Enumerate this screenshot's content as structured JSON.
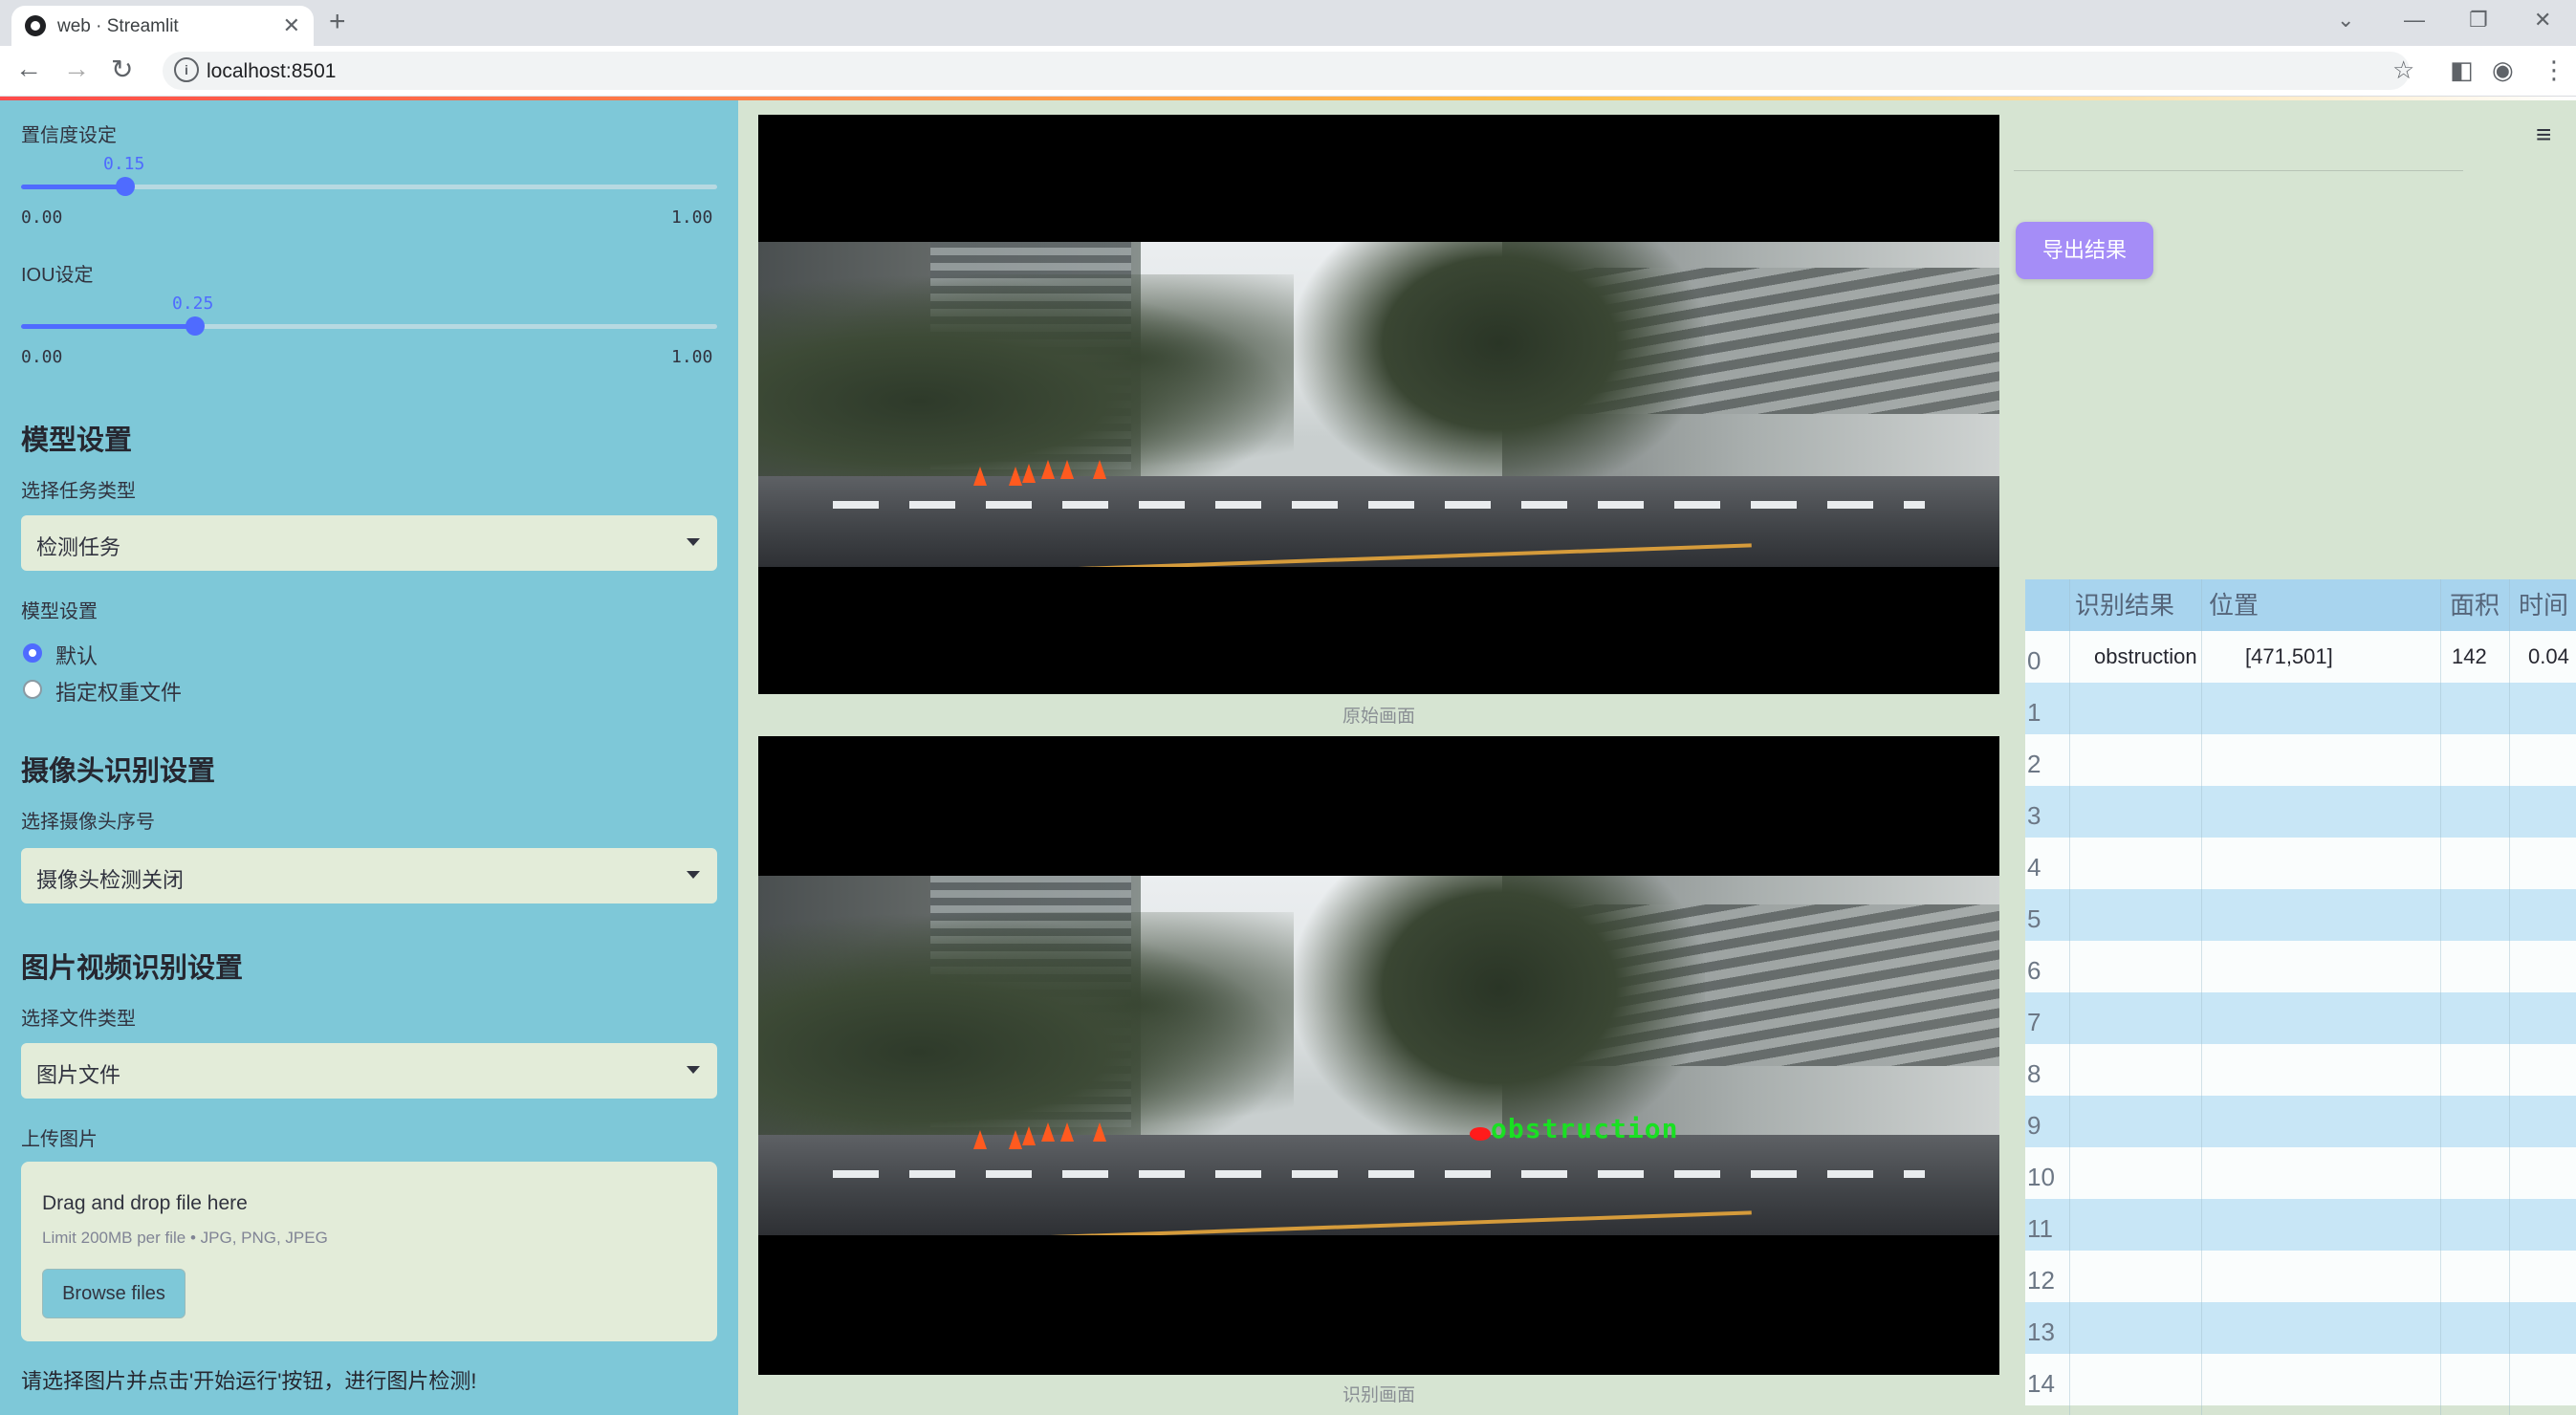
{
  "browser": {
    "tab_title": "web · Streamlit",
    "url": "localhost:8501"
  },
  "sidebar": {
    "confidence": {
      "label": "置信度设定",
      "value": 0.15,
      "value_text": "0.15",
      "min": "0.00",
      "max": "1.00"
    },
    "iou": {
      "label": "IOU设定",
      "value": 0.25,
      "value_text": "0.25",
      "min": "0.00",
      "max": "1.00"
    },
    "model_section": "模型设置",
    "task_label": "选择任务类型",
    "task_value": "检测任务",
    "model_label": "模型设置",
    "model_options": [
      "默认",
      "指定权重文件"
    ],
    "model_selected": "默认",
    "camera_section": "摄像头识别设置",
    "camera_label": "选择摄像头序号",
    "camera_value": "摄像头检测关闭",
    "file_section": "图片视频识别设置",
    "file_type_label": "选择文件类型",
    "file_type_value": "图片文件",
    "upload_label": "上传图片",
    "upload_title": "Drag and drop file here",
    "upload_limit": "Limit 200MB per file • JPG, PNG, JPEG",
    "browse_label": "Browse files",
    "hint": "请选择图片并点击'开始运行'按钮，进行图片检测!"
  },
  "main": {
    "original_caption": "原始画面",
    "detected_caption": "识别画面",
    "detection_label": "obstruction",
    "export_label": "导出结果"
  },
  "table": {
    "headers": [
      "识别结果",
      "位置",
      "面积",
      "时间"
    ],
    "rows": [
      {
        "idx": "0",
        "result": "obstruction",
        "position": "[471,501]",
        "area": "142",
        "time": "0.04"
      },
      {
        "idx": "1"
      },
      {
        "idx": "2"
      },
      {
        "idx": "3"
      },
      {
        "idx": "4"
      },
      {
        "idx": "5"
      },
      {
        "idx": "6"
      },
      {
        "idx": "7"
      },
      {
        "idx": "8"
      },
      {
        "idx": "9"
      },
      {
        "idx": "10"
      },
      {
        "idx": "11"
      },
      {
        "idx": "12"
      },
      {
        "idx": "13"
      },
      {
        "idx": "14"
      }
    ]
  },
  "colors": {
    "sidebar": "#7ec8d8",
    "accent": "#4f6bff",
    "export_button": "#a58df7",
    "detection_text": "#19e022"
  }
}
